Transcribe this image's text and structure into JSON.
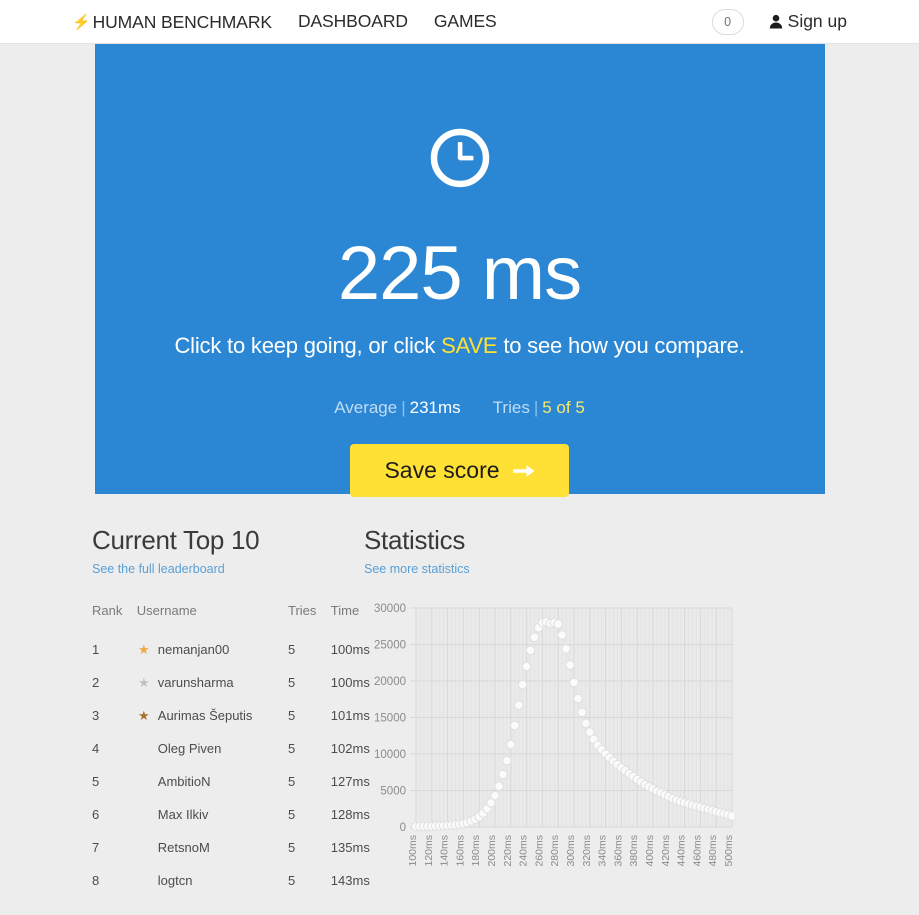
{
  "navbar": {
    "bolt_icon": "bolt-icon",
    "brand": "HUMAN BENCHMARK",
    "links": [
      {
        "label": "DASHBOARD"
      },
      {
        "label": "GAMES"
      }
    ],
    "count_badge": "0",
    "person_icon": "person-icon",
    "signup_label": "Sign up"
  },
  "hero": {
    "clock_icon": "clock-icon",
    "time": "225 ms",
    "subtitle_pre": "Click to keep going, or click ",
    "subtitle_highlight": "SAVE",
    "subtitle_post": " to see how you compare.",
    "average_label": "Average",
    "separator": "|",
    "average_value": "231ms",
    "tries_label": "Tries",
    "tries_value": "5 of 5",
    "save_button": "Save score",
    "arrow_icon": "arrow-right-icon",
    "accent_bg": "#2b87d4",
    "accent_yellow": "#ffe034"
  },
  "leaderboard": {
    "title": "Current Top 10",
    "link": "See the full leaderboard",
    "columns": [
      "Rank",
      "Username",
      "Tries",
      "Time"
    ],
    "rows": [
      {
        "rank": "1",
        "medal": "gold",
        "username": "nemanjan00",
        "tries": "5",
        "time": "100ms"
      },
      {
        "rank": "2",
        "medal": "silver",
        "username": "varunsharma",
        "tries": "5",
        "time": "100ms"
      },
      {
        "rank": "3",
        "medal": "bronze",
        "username": "Aurimas Šeputis",
        "tries": "5",
        "time": "101ms"
      },
      {
        "rank": "4",
        "medal": "none",
        "username": "Oleg Piven",
        "tries": "5",
        "time": "102ms"
      },
      {
        "rank": "5",
        "medal": "none",
        "username": "AmbitioN",
        "tries": "5",
        "time": "127ms"
      },
      {
        "rank": "6",
        "medal": "none",
        "username": "Max Ilkiv",
        "tries": "5",
        "time": "128ms"
      },
      {
        "rank": "7",
        "medal": "none",
        "username": "RetsnoM",
        "tries": "5",
        "time": "135ms"
      },
      {
        "rank": "8",
        "medal": "none",
        "username": "logtcn",
        "tries": "5",
        "time": "143ms"
      }
    ],
    "medal_colors": {
      "gold": "#efa83c",
      "silver": "#c2c2c2",
      "bronze": "#a5742a"
    }
  },
  "statistics": {
    "title": "Statistics",
    "link": "See more statistics"
  },
  "chart_data": {
    "type": "scatter",
    "title": "Statistics",
    "xlabel": "",
    "ylabel": "",
    "xlim": [
      100,
      500
    ],
    "ylim": [
      0,
      30000
    ],
    "grid": true,
    "legend": "none",
    "yticks": [
      0,
      5000,
      10000,
      15000,
      20000,
      25000,
      30000
    ],
    "ytick_labels": [
      "0",
      "5000",
      "10000",
      "15000",
      "20000",
      "25000",
      "30000"
    ],
    "xtick_labels": [
      "100ms",
      "120ms",
      "140ms",
      "160ms",
      "180ms",
      "200ms",
      "220ms",
      "240ms",
      "260ms",
      "280ms",
      "300ms",
      "320ms",
      "340ms",
      "360ms",
      "380ms",
      "400ms",
      "420ms",
      "440ms",
      "460ms",
      "480ms",
      "500ms"
    ],
    "x": [
      100,
      105,
      110,
      115,
      120,
      125,
      130,
      135,
      140,
      145,
      150,
      155,
      160,
      165,
      170,
      175,
      180,
      185,
      190,
      195,
      200,
      205,
      210,
      215,
      220,
      225,
      230,
      235,
      240,
      245,
      250,
      255,
      260,
      265,
      270,
      275,
      280,
      285,
      290,
      295,
      300,
      305,
      310,
      315,
      320,
      325,
      330,
      335,
      340,
      345,
      350,
      355,
      360,
      365,
      370,
      375,
      380,
      385,
      390,
      395,
      400,
      405,
      410,
      415,
      420,
      425,
      430,
      435,
      440,
      445,
      450,
      455,
      460,
      465,
      470,
      475,
      480,
      485,
      490,
      495,
      500
    ],
    "y": [
      60,
      70,
      80,
      95,
      110,
      130,
      150,
      180,
      210,
      250,
      300,
      380,
      480,
      620,
      800,
      1050,
      1400,
      1900,
      2500,
      3300,
      4300,
      5600,
      7200,
      9100,
      11300,
      13900,
      16700,
      19500,
      22000,
      24200,
      26000,
      27300,
      28000,
      28100,
      27900,
      28000,
      27800,
      26300,
      24400,
      22200,
      19800,
      17600,
      15700,
      14200,
      13000,
      12000,
      11200,
      10600,
      10000,
      9500,
      9000,
      8550,
      8100,
      7700,
      7300,
      6900,
      6500,
      6150,
      5800,
      5500,
      5200,
      4900,
      4650,
      4400,
      4150,
      3900,
      3700,
      3500,
      3300,
      3150,
      3000,
      2850,
      2700,
      2550,
      2400,
      2250,
      2100,
      1950,
      1800,
      1650,
      1500
    ]
  }
}
